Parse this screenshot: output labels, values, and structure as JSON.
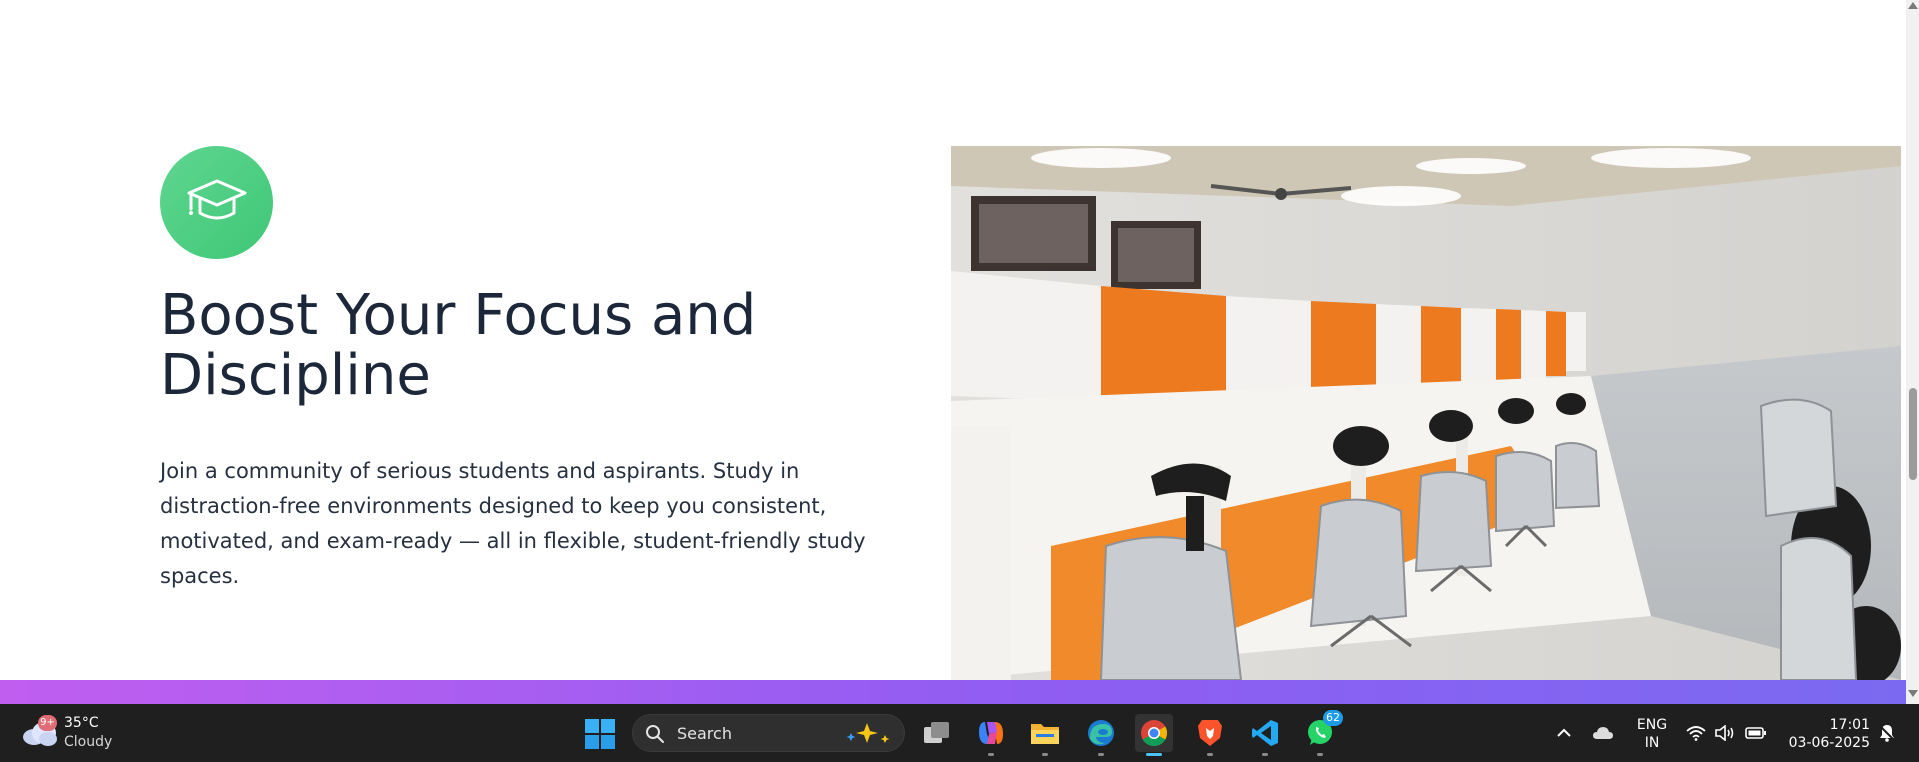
{
  "section": {
    "heading": "Boost Your Focus and Discipline",
    "description": "Join a community of serious students and aspirants. Study in distraction-free environments designed to keep you consistent, motivated, and exam-ready — all in flexible, student-friendly study spaces.",
    "icon": "graduation-cap-icon",
    "icon_color": "#4cce82",
    "image": "study-room-photo"
  },
  "taskbar": {
    "weather": {
      "badge": "9+",
      "temperature": "35°C",
      "condition": "Cloudy"
    },
    "search": {
      "placeholder": "Search"
    },
    "apps": [
      {
        "name": "Task View",
        "icon": "task-view-icon"
      },
      {
        "name": "Copilot",
        "icon": "copilot-icon"
      },
      {
        "name": "File Explorer",
        "icon": "folder-icon"
      },
      {
        "name": "Microsoft Edge",
        "icon": "edge-icon"
      },
      {
        "name": "Google Chrome",
        "icon": "chrome-icon",
        "active": true
      },
      {
        "name": "Brave",
        "icon": "brave-icon"
      },
      {
        "name": "Visual Studio Code",
        "icon": "vscode-icon"
      },
      {
        "name": "WhatsApp",
        "icon": "whatsapp-icon",
        "badge": "62"
      }
    ],
    "tray": {
      "language_line1": "ENG",
      "language_line2": "IN",
      "time": "17:01",
      "date": "03-06-2025"
    }
  },
  "colors": {
    "heading": "#1c2739",
    "gradient_start": "#c05ef0",
    "gradient_end": "#7b6af1",
    "taskbar_bg": "#1f1f1f",
    "active_indicator": "#4cc2ff"
  }
}
